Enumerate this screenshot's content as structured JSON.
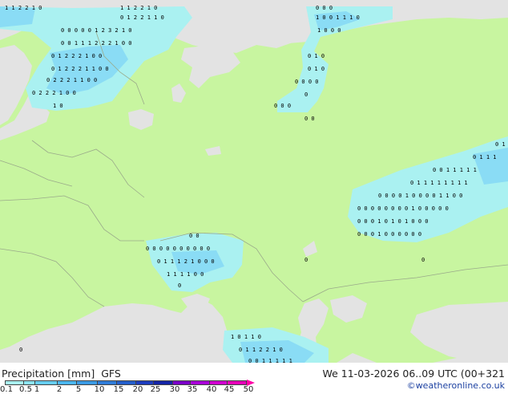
{
  "legend": {
    "title": "Precipitation [mm]",
    "model": "GFS",
    "run": "We 11-03-2026 06..09 UTC (00+321",
    "credit": "©weatheronline.co.uk",
    "ticks": [
      "0.1",
      "0.5",
      "1",
      "2",
      "5",
      "10",
      "15",
      "20",
      "25",
      "30",
      "35",
      "40",
      "45",
      "50"
    ],
    "colors": [
      "#a8f0f0",
      "#8ce3f0",
      "#66cdf0",
      "#4bb6ef",
      "#3b9ae4",
      "#2f7cd8",
      "#245ecb",
      "#1c3cbe",
      "#1424a6",
      "#7a00c8",
      "#a800d8",
      "#d000d0",
      "#e600b8",
      "#ff00a8"
    ]
  },
  "map": {
    "colors": {
      "land": "#c8f5a0",
      "sea": "#e3e3e3",
      "precip_light": "#aaf1f1",
      "precip_medium": "#8adcf5",
      "precip_heavy": "#6ec8f0",
      "border": "#9aaa8a",
      "label": "#000000"
    }
  }
}
